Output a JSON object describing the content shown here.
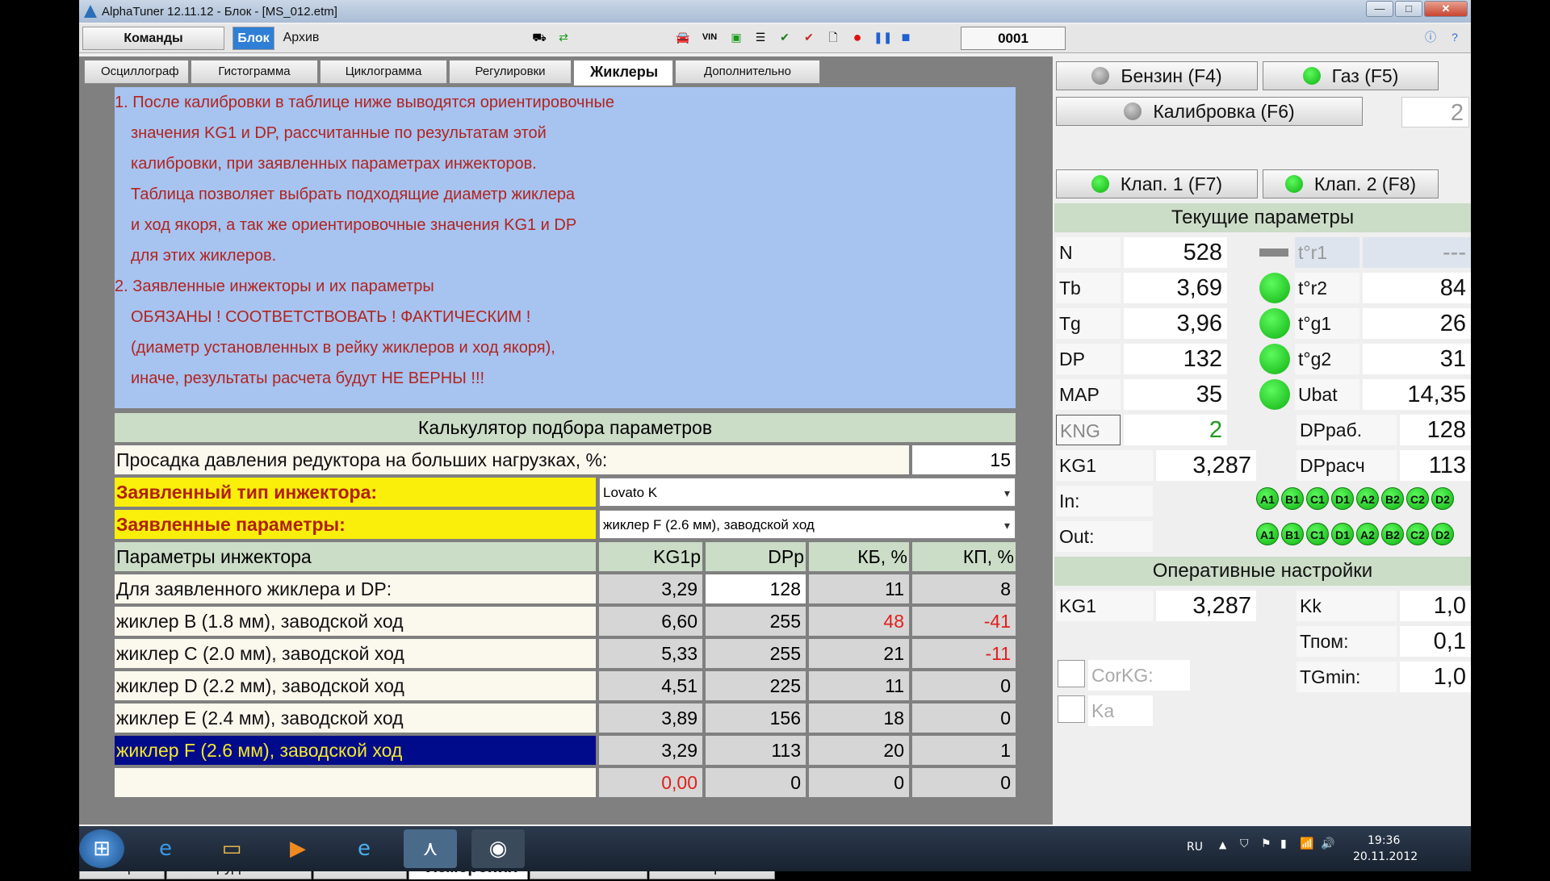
{
  "window": {
    "title": "AlphaTuner 12.11.12 - Блок - [MS_012.etm]",
    "minimize": "—",
    "maximize": "□",
    "close": "✕"
  },
  "toolbar": {
    "commands": "Команды",
    "block": "Блок",
    "archive": "Архив",
    "counter": "0001",
    "vin": "VIN"
  },
  "top_tabs": [
    "Осциллограф",
    "Гистограмма",
    "Циклограмма",
    "Регулировки",
    "Жиклеры",
    "Дополнительно"
  ],
  "info_lines": [
    "1. После калибровки в таблице ниже выводятся ориентировочные",
    "значения  KG1  и  DP, рассчитанные  по  результатам этой",
    "калибровки, при заявленных параметрах инжекторов.",
    "Таблица  позволяет  выбрать  подходящие  диаметр жиклера",
    "и ход якоря, а так же ориентировочные значения  KG1 и DP",
    "для этих жиклеров.",
    "2. Заявленные инжекторы и их параметры",
    "ОБЯЗАНЫ ! СООТВЕТСТВОВАТЬ ! ФАКТИЧЕСКИМ !",
    "(диаметр установленных в рейку жиклеров и ход якоря),",
    "иначе, результаты расчета будут НЕ ВЕРНЫ !!!"
  ],
  "calc": {
    "title": "Калькулятор подбора параметров",
    "drop_label": "Просадка давления редуктора на больших нагрузках, %:",
    "drop_value": "15",
    "type_label": "Заявленный тип инжектора:",
    "type_value": "Lovato K",
    "params_label": "Заявленные параметры:",
    "params_value": "жиклер F (2.6 мм), заводской ход",
    "headers": [
      "Параметры инжектора",
      "KG1р",
      "DPр",
      "КБ, %",
      "КП, %"
    ],
    "rows": [
      {
        "name": "Для заявленного жиклера и DP:",
        "kg1": "3,29",
        "dp": "128",
        "kb": "11",
        "kp": "8"
      },
      {
        "name": "жиклер B (1.8 мм), заводской ход",
        "kg1": "6,60",
        "dp": "255",
        "kb": "48",
        "kp": "-41"
      },
      {
        "name": "жиклер C (2.0 мм), заводской ход",
        "kg1": "5,33",
        "dp": "255",
        "kb": "21",
        "kp": "-11"
      },
      {
        "name": "жиклер D (2.2 мм), заводской ход",
        "kg1": "4,51",
        "dp": "225",
        "kb": "11",
        "kp": "0"
      },
      {
        "name": "жиклер E (2.4 мм), заводской ход",
        "kg1": "3,89",
        "dp": "156",
        "kb": "18",
        "kp": "0"
      },
      {
        "name": "жиклер F (2.6 мм), заводской ход",
        "kg1": "3,29",
        "dp": "113",
        "kb": "20",
        "kp": "1"
      },
      {
        "name": "",
        "kg1": "0,00",
        "dp": "0",
        "kb": "0",
        "kp": "0"
      }
    ]
  },
  "bottom_tabs": [
    "Общие",
    "Оборудование",
    "Режимы",
    "Измерения",
    "Статистика",
    "Калибровки"
  ],
  "right": {
    "petrol": "Бензин (F4)",
    "gas": "Газ     (F5)",
    "calib": "Калибровка (F6)",
    "calib_value": "2",
    "valve1": "Клап. 1 (F7)",
    "valve2": "Клап. 2 (F8)",
    "current_title": "Текущие параметры",
    "params": [
      {
        "l": "N",
        "v": "528"
      },
      {
        "l": "Tb",
        "v": "3,69"
      },
      {
        "l": "Tg",
        "v": "3,96"
      },
      {
        "l": "DP",
        "v": "132"
      },
      {
        "l": "MAP",
        "v": "35"
      }
    ],
    "temps": [
      {
        "l": "t°r1",
        "v": "---"
      },
      {
        "l": "t°r2",
        "v": "84"
      },
      {
        "l": "t°g1",
        "v": "26"
      },
      {
        "l": "t°g2",
        "v": "31"
      },
      {
        "l": "Ubat",
        "v": "14,35"
      }
    ],
    "kng_label": "KNG",
    "kng_value": "2",
    "dpwork_label": "DPраб.",
    "dpwork_value": "128",
    "kg1_label": "KG1",
    "kg1_value": "3,287",
    "dpcalc_label": "DPрасч",
    "dpcalc_value": "113",
    "in_label": "In:",
    "out_label": "Out:",
    "io_leds": [
      "A1",
      "B1",
      "C1",
      "D1",
      "A2",
      "B2",
      "C2",
      "D2"
    ],
    "oper_title": "Оперативные настройки",
    "op_kg1_label": "KG1",
    "op_kg1_value": "3,287",
    "kk_label": "Kk",
    "kk_value": "1,0",
    "tpom_label": "Тпом:",
    "tpom_value": "0,1",
    "tgmin_label": "TGmin:",
    "tgmin_value": "1,0",
    "corkg_label": "CorKG:",
    "ka_label": "Ka"
  },
  "taskbar": {
    "lang": "RU",
    "time": "19:36",
    "date": "20.11.2012"
  },
  "colors": {
    "info_bg": "#a7c3f0",
    "info_text": "#b0241f",
    "highlight": "#f9ef0a",
    "selected_row": "#000b8c",
    "led_green": "#1fd21f"
  }
}
